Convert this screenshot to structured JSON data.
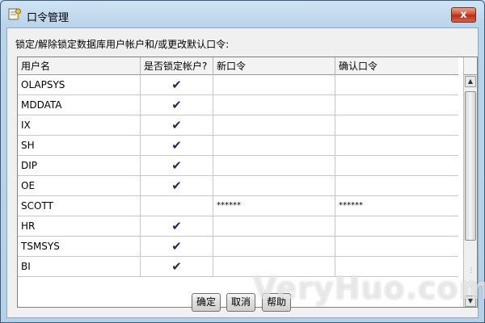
{
  "window": {
    "title": "口令管理",
    "close_label": "x",
    "colors": {
      "title_bg": "#cfe3f4",
      "client_bg": "#f0f0f0",
      "checkmark": "#1f2a5e",
      "close_red": "#c8432b"
    }
  },
  "prompt": "锁定/解除锁定数据库用户帐户和/或更改默认口令:",
  "table": {
    "headers": [
      "用户名",
      "是否锁定帐户?",
      "新口令",
      "确认口令"
    ],
    "rows": [
      {
        "user": "OLAPSYS",
        "locked": "✔",
        "new_password": "",
        "confirm_password": ""
      },
      {
        "user": "MDDATA",
        "locked": "✔",
        "new_password": "",
        "confirm_password": ""
      },
      {
        "user": "IX",
        "locked": "✔",
        "new_password": "",
        "confirm_password": ""
      },
      {
        "user": "SH",
        "locked": "✔",
        "new_password": "",
        "confirm_password": ""
      },
      {
        "user": "DIP",
        "locked": "✔",
        "new_password": "",
        "confirm_password": ""
      },
      {
        "user": "OE",
        "locked": "✔",
        "new_password": "",
        "confirm_password": ""
      },
      {
        "user": "SCOTT",
        "locked": "",
        "new_password": "******",
        "confirm_password": "******"
      },
      {
        "user": "HR",
        "locked": "✔",
        "new_password": "",
        "confirm_password": ""
      },
      {
        "user": "TSMSYS",
        "locked": "✔",
        "new_password": "",
        "confirm_password": ""
      },
      {
        "user": "BI",
        "locked": "✔",
        "new_password": "",
        "confirm_password": ""
      }
    ]
  },
  "scrollbar": {
    "up_icon": "▲",
    "down_icon": "▼",
    "grip": "⋮⋮"
  },
  "buttons": {
    "ok": "确定",
    "cancel": "取消",
    "help": "帮助"
  },
  "watermark": "VeryHuo.com"
}
